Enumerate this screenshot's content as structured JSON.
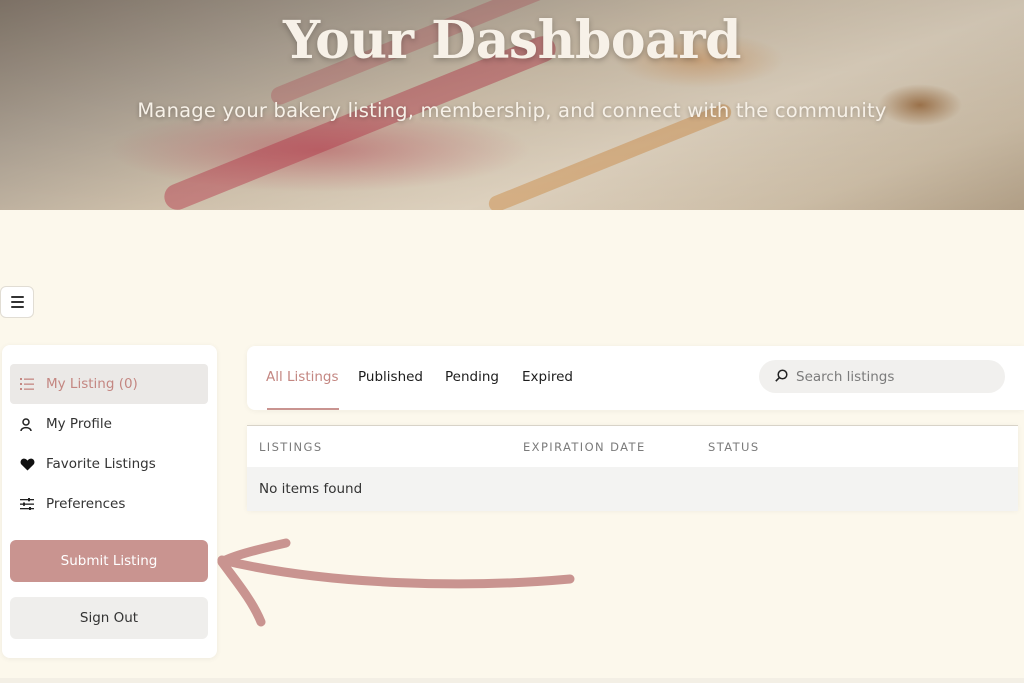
{
  "hero": {
    "title": "Your Dashboard",
    "subtitle": "Manage your bakery listing, membership, and connect with the community"
  },
  "sidebar": {
    "items": [
      {
        "label": "My Listing (0)",
        "icon": "list-icon",
        "active": true
      },
      {
        "label": "My Profile",
        "icon": "user-icon",
        "active": false
      },
      {
        "label": "Favorite Listings",
        "icon": "heart-icon",
        "active": false
      },
      {
        "label": "Preferences",
        "icon": "sliders-icon",
        "active": false
      }
    ],
    "submit_label": "Submit Listing",
    "signout_label": "Sign Out"
  },
  "tabs": [
    {
      "label": "All Listings",
      "active": true
    },
    {
      "label": "Published",
      "active": false
    },
    {
      "label": "Pending",
      "active": false
    },
    {
      "label": "Expired",
      "active": false
    }
  ],
  "search": {
    "placeholder": "Search listings",
    "icon": "search-icon"
  },
  "table": {
    "columns": [
      "LISTINGS",
      "EXPIRATION DATE",
      "STATUS"
    ],
    "empty_text": "No items found"
  },
  "colors": {
    "accent": "#c99490",
    "accent_text": "#c48782",
    "background": "#fcf8ec",
    "arrow": "#c99490"
  }
}
